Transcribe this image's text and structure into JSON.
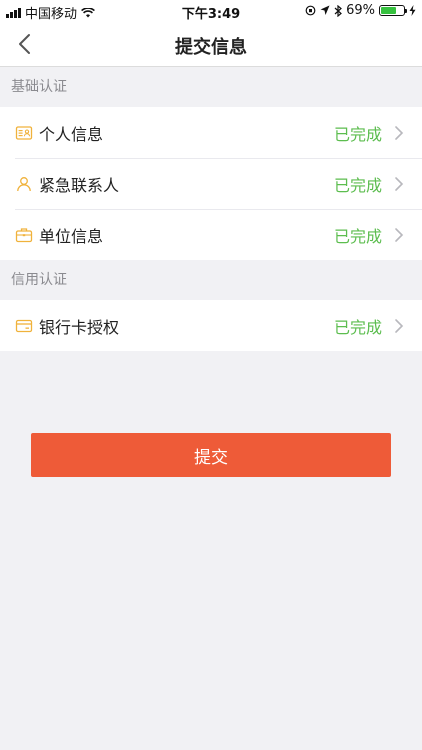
{
  "status_bar": {
    "carrier": "中国移动",
    "time": "下午3:49",
    "battery": "69%",
    "battery_level": 0.69
  },
  "nav": {
    "title": "提交信息"
  },
  "sections": [
    {
      "header": "基础认证",
      "items": [
        {
          "label": "个人信息",
          "status": "已完成",
          "icon": "id-card-icon"
        },
        {
          "label": "紧急联系人",
          "status": "已完成",
          "icon": "person-icon"
        },
        {
          "label": "单位信息",
          "status": "已完成",
          "icon": "briefcase-icon"
        }
      ]
    },
    {
      "header": "信用认证",
      "items": [
        {
          "label": "银行卡授权",
          "status": "已完成",
          "icon": "bank-card-icon"
        }
      ]
    }
  ],
  "submit": {
    "label": "提交"
  },
  "colors": {
    "accent": "#ee5b38",
    "icon": "#f0b23c",
    "status_done": "#5cbd4f"
  }
}
